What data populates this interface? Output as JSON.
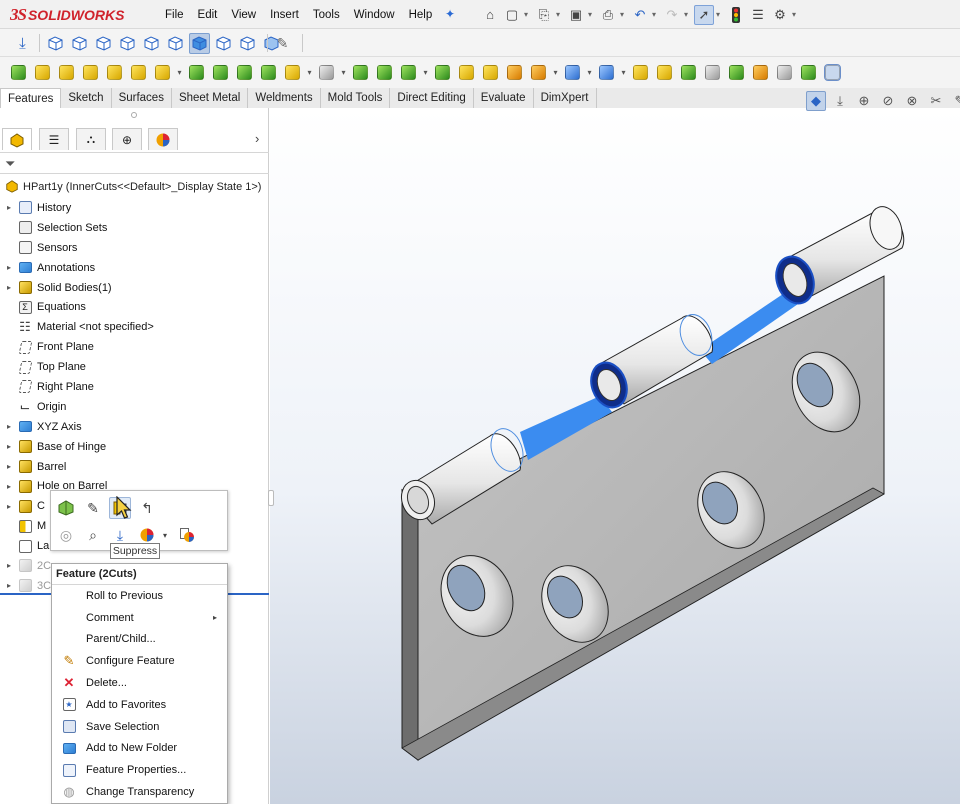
{
  "app": {
    "logo_ds": "3S",
    "logo_text": "SOLIDWORKS"
  },
  "menu": [
    "File",
    "Edit",
    "View",
    "Insert",
    "Tools",
    "Window",
    "Help"
  ],
  "quick_access_icons": [
    "home-icon",
    "new-document-icon",
    "open-icon",
    "save-icon",
    "print-icon",
    "undo-icon",
    "redo-icon",
    "select-icon",
    "traffic-light-icon",
    "file-properties-icon",
    "options-gear-icon"
  ],
  "command_tabs": [
    "Features",
    "Sketch",
    "Surfaces",
    "Sheet Metal",
    "Weldments",
    "Mold Tools",
    "Direct Editing",
    "Evaluate",
    "DimXpert"
  ],
  "active_tab": "Features",
  "feature_tree": {
    "root": "HPart1y (InnerCuts<<Default>_Display State 1>)",
    "items": [
      {
        "label": "History",
        "expand": true,
        "icon": "history-icon"
      },
      {
        "label": "Selection Sets",
        "expand": false,
        "icon": "selection-sets-icon"
      },
      {
        "label": "Sensors",
        "expand": false,
        "icon": "sensors-icon"
      },
      {
        "label": "Annotations",
        "expand": true,
        "icon": "annotations-icon"
      },
      {
        "label": "Solid Bodies(1)",
        "expand": true,
        "icon": "solid-bodies-icon"
      },
      {
        "label": "Equations",
        "expand": false,
        "icon": "equations-icon"
      },
      {
        "label": "Material <not specified>",
        "expand": false,
        "icon": "material-icon"
      },
      {
        "label": "Front Plane",
        "expand": false,
        "icon": "plane-icon"
      },
      {
        "label": "Top Plane",
        "expand": false,
        "icon": "plane-icon"
      },
      {
        "label": "Right Plane",
        "expand": false,
        "icon": "plane-icon"
      },
      {
        "label": "Origin",
        "expand": false,
        "icon": "origin-icon"
      },
      {
        "label": "XYZ Axis",
        "expand": true,
        "icon": "folder-icon"
      },
      {
        "label": "Base of Hinge",
        "expand": true,
        "icon": "feature-icon"
      },
      {
        "label": "Barrel",
        "expand": true,
        "icon": "feature-icon"
      },
      {
        "label": "Hole on Barrel",
        "expand": true,
        "icon": "feature-icon"
      },
      {
        "label": "C",
        "expand": true,
        "icon": "feature-icon"
      },
      {
        "label": "M",
        "expand": false,
        "icon": "mirror-icon"
      },
      {
        "label": "La",
        "expand": false,
        "icon": "sketch-icon"
      },
      {
        "label": "2C",
        "expand": true,
        "icon": "cut-icon"
      },
      {
        "label": "3C",
        "expand": true,
        "icon": "cut-icon"
      }
    ]
  },
  "context_toolbar": {
    "tooltip": "Suppress",
    "row1": [
      "edit-feature-icon",
      "edit-sketch-icon",
      "suppress-icon",
      "rollback-icon"
    ],
    "row2": [
      "hide-icon",
      "zoom-to-selection-icon",
      "insert-icon",
      "appearance-icon",
      "appearance-dropdown-icon",
      "appearance-callout-icon"
    ]
  },
  "context_menu": {
    "title": "Feature (2Cuts)",
    "items": [
      {
        "label": "Roll to Previous",
        "icon": "",
        "submenu": false
      },
      {
        "label": "Comment",
        "icon": "",
        "submenu": true
      },
      {
        "label": "Parent/Child...",
        "icon": "",
        "submenu": false
      },
      {
        "label": "Configure Feature",
        "icon": "configure-icon",
        "submenu": false
      },
      {
        "label": "Delete...",
        "icon": "delete-icon",
        "submenu": false
      },
      {
        "label": "Add to Favorites",
        "icon": "favorites-icon",
        "submenu": false
      },
      {
        "label": "Save Selection",
        "icon": "save-selection-icon",
        "submenu": false
      },
      {
        "label": "Add to New Folder",
        "icon": "folder-icon",
        "submenu": false
      },
      {
        "label": "Feature Properties...",
        "icon": "properties-icon",
        "submenu": false
      },
      {
        "label": "Change Transparency",
        "icon": "transparency-icon",
        "submenu": false
      }
    ]
  },
  "colors": {
    "accent": "#2a64c5",
    "highlight_edge": "#1a4fc4",
    "selection_fill": "#3b8cf0",
    "part_gray": "#b5b5b5",
    "logo_red": "#d0222b"
  }
}
